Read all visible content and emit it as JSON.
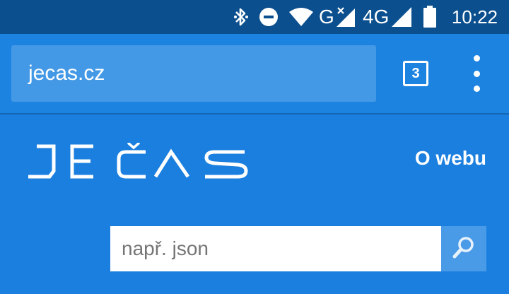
{
  "status_bar": {
    "time": "10:22",
    "network_label_g": "G",
    "network_label_4g": "4G",
    "icons": [
      "bluetooth-icon",
      "do-not-disturb-icon",
      "wifi-icon",
      "signal-no-data-icon",
      "signal-icon",
      "battery-icon"
    ]
  },
  "browser": {
    "url": "jecas.cz",
    "tab_count": "3",
    "menu_icon": "more-vert-icon"
  },
  "site": {
    "logo_text": "JE ČAS",
    "about_link": "O webu",
    "search": {
      "placeholder": "např. json",
      "value": "",
      "button_icon": "search-icon"
    }
  },
  "colors": {
    "status_bar": "#0b4f8e",
    "toolbar": "#1d83e0",
    "url_field": "#4499e6",
    "page_background": "#1a7fdf",
    "search_button": "#4a9be7"
  }
}
